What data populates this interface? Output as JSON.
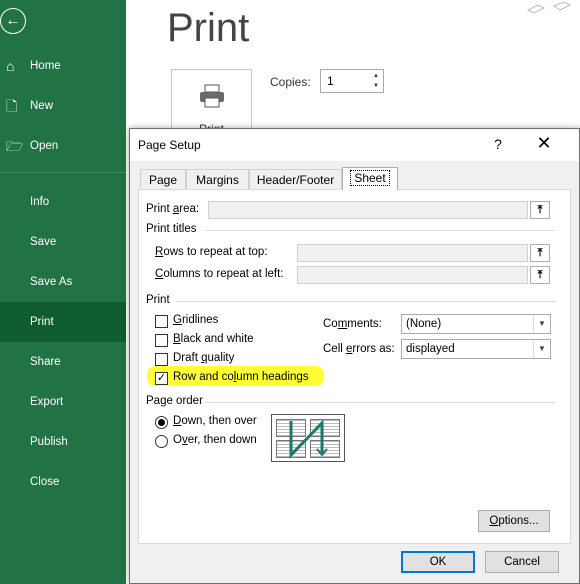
{
  "sidebar": {
    "items": [
      {
        "label": "Home",
        "icon": "home-icon"
      },
      {
        "label": "New",
        "icon": "new-file-icon"
      },
      {
        "label": "Open",
        "icon": "folder-open-icon"
      },
      {
        "label": "Info"
      },
      {
        "label": "Save"
      },
      {
        "label": "Save As"
      },
      {
        "label": "Print",
        "active": true
      },
      {
        "label": "Share"
      },
      {
        "label": "Export"
      },
      {
        "label": "Publish"
      },
      {
        "label": "Close"
      }
    ],
    "bg_color": "#217346"
  },
  "main": {
    "title": "Print",
    "print_button_label": "Print",
    "copies_label": "Copies:",
    "copies_value": "1"
  },
  "dialog": {
    "title": "Page Setup",
    "help": "?",
    "close": "✕",
    "tabs": [
      "Page",
      "Margins",
      "Header/Footer",
      "Sheet"
    ],
    "selected_tab": "Sheet",
    "print_area": {
      "pre": "Print ",
      "u": "a",
      "post": "rea:"
    },
    "print_titles": "Print titles",
    "rows_repeat": {
      "pre": "",
      "u": "R",
      "post": "ows to repeat at top:"
    },
    "cols_repeat": {
      "pre": "",
      "u": "C",
      "post": "olumns to repeat at left:"
    },
    "print_group": "Print",
    "checkboxes": [
      {
        "pre": "",
        "u": "G",
        "post": "ridlines",
        "checked": false
      },
      {
        "pre": "",
        "u": "B",
        "post": "lack and white",
        "checked": false
      },
      {
        "pre": "Draft ",
        "u": "q",
        "post": "uality",
        "checked": false
      },
      {
        "pre": "Row and co",
        "u": "l",
        "post": "umn headings",
        "checked": true
      }
    ],
    "comments": {
      "pre": "Co",
      "u": "m",
      "post": "ments:",
      "value": "(None)"
    },
    "cell_errors": {
      "pre": "Cell ",
      "u": "e",
      "post": "rrors as:",
      "value": "displayed"
    },
    "page_order_group": "Page order",
    "radios": [
      {
        "pre": "",
        "u": "D",
        "post": "own, then over",
        "selected": true
      },
      {
        "pre": "O",
        "u": "v",
        "post": "er, then down",
        "selected": false
      }
    ],
    "options_label": {
      "pre": "",
      "u": "O",
      "post": "ptions..."
    },
    "ok_label": "OK",
    "cancel_label": "Cancel",
    "highlight_color": "#ffff33"
  }
}
